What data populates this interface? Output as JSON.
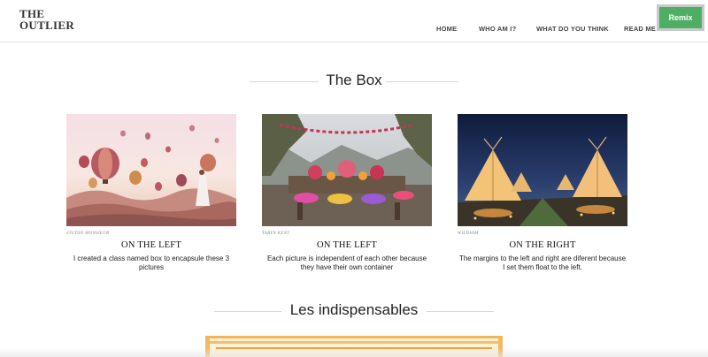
{
  "header": {
    "logo_line1": "THE",
    "logo_line2": "OUTLIER",
    "nav": [
      "HOME",
      "WHO AM I?",
      "WHAT DO YOU THINK",
      "READ ME"
    ],
    "remix_label": "Remix"
  },
  "sections": {
    "box_title": "The Box",
    "indispensables_title": "Les indispensables"
  },
  "cards": [
    {
      "credit": "STUDIO MONSIEUR",
      "heading": "ON THE LEFT",
      "text": "I created a class named box to encapsule these 3 pictures"
    },
    {
      "credit": "TARYN KENT",
      "heading": "ON THE LEFT",
      "text": "Each picture is independent of each other because they have their own container"
    },
    {
      "credit": "WILDHIM",
      "heading": "ON THE RIGHT",
      "text": "The margins to the left and right are diferent because I set them float to the left."
    }
  ],
  "colors": {
    "remix_green": "#4caf63",
    "divider": "#d8d8d8"
  }
}
